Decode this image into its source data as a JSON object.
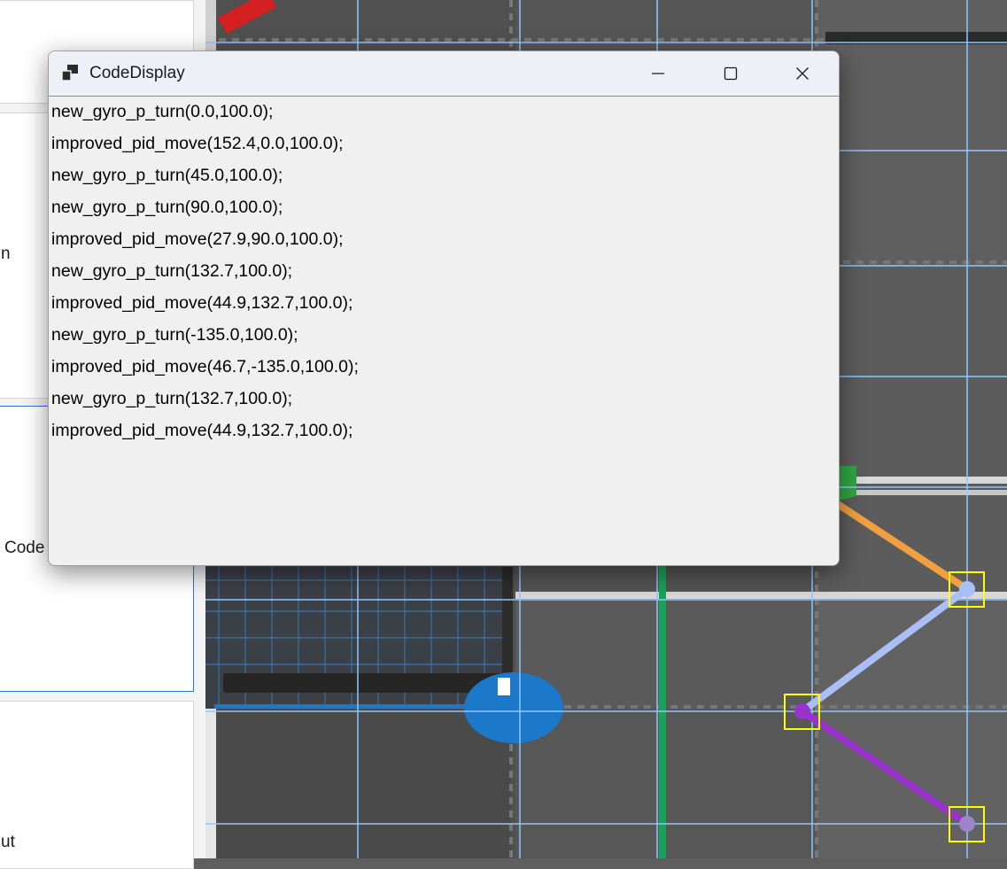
{
  "window": {
    "title": "CodeDisplay",
    "icon": "window-app-icon",
    "controls": [
      "minimize-icon",
      "maximize-icon",
      "close-icon"
    ]
  },
  "code_lines": [
    "new_gyro_p_turn(0.0,100.0);",
    "improved_pid_move(152.4,0.0,100.0);",
    "new_gyro_p_turn(45.0,100.0);",
    "new_gyro_p_turn(90.0,100.0);",
    "improved_pid_move(27.9,90.0,100.0);",
    "new_gyro_p_turn(132.7,100.0);",
    "improved_pid_move(44.9,132.7,100.0);",
    "new_gyro_p_turn(-135.0,100.0);",
    "improved_pid_move(46.7,-135.0,100.0);",
    "new_gyro_p_turn(132.7,100.0);",
    "improved_pid_move(44.9,132.7,100.0);"
  ],
  "background_fragments": {
    "frag_n": "n",
    "frag_code": "Code",
    "frag_ut": "ut"
  },
  "colors": {
    "grid_line": "#8ec8ff",
    "path_orange": "#f0a040",
    "path_lightblue": "#aabff5",
    "path_purple": "#9933cc",
    "waypoint_box": "#ffff00",
    "green_line": "#1aa15a",
    "blue_part": "#1c78c8",
    "red_part": "#d42020"
  }
}
